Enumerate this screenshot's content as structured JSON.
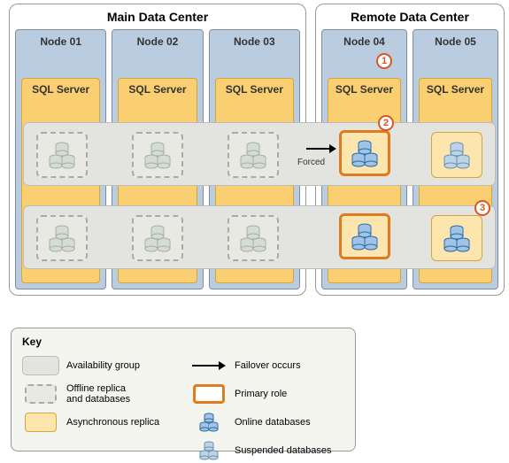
{
  "datacenters": {
    "main": {
      "title": "Main Data Center"
    },
    "remote": {
      "title": "Remote Data Center"
    }
  },
  "nodes": {
    "n1": "Node 01",
    "n2": "Node 02",
    "n3": "Node 03",
    "n4": "Node 04",
    "n5": "Node 05"
  },
  "sql_label": "SQL Server",
  "forced_label": "Forced",
  "callouts": {
    "c1": "1",
    "c2": "2",
    "c3": "3"
  },
  "key": {
    "title": "Key",
    "ag": "Availability group",
    "offline": "Offline replica\nand databases",
    "async": "Asynchronous replica",
    "failover": "Failover occurs",
    "primary": "Primary role",
    "online": "Online databases",
    "suspended": "Suspended databases"
  }
}
